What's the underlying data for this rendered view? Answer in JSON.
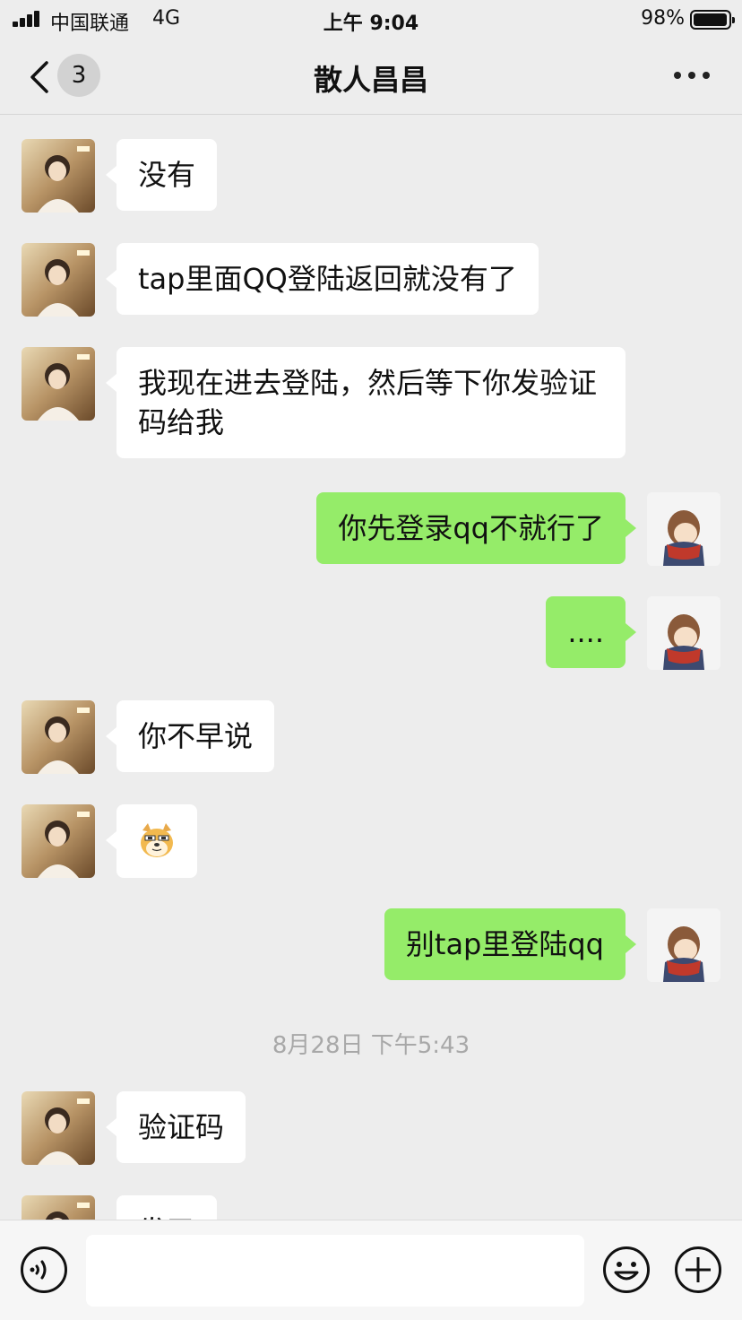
{
  "status_bar": {
    "carrier": "中国联通",
    "network": "4G",
    "time": "上午 9:04",
    "battery": "98%",
    "battery_level": 0.98
  },
  "nav": {
    "unread_count": "3",
    "title": "散人昌昌"
  },
  "messages": [
    {
      "side": "in",
      "text": "没有"
    },
    {
      "side": "in",
      "text": "tap里面QQ登陆返回就没有了"
    },
    {
      "side": "in",
      "text": "我现在进去登陆，然后等下你发验证码给我"
    },
    {
      "side": "out",
      "text": "你先登录qq不就行了"
    },
    {
      "side": "out",
      "text": "...."
    },
    {
      "side": "in",
      "text": "你不早说"
    },
    {
      "side": "in",
      "sticker": "doge-emoji-icon"
    },
    {
      "side": "out",
      "text": "别tap里登陆qq"
    },
    {
      "side": "in",
      "text": "验证码"
    },
    {
      "side": "in",
      "text": "发了"
    }
  ],
  "divider_timestamp": "8月28日 下午5:43",
  "colors": {
    "background": "#ededed",
    "outgoing_bubble": "#95ec69",
    "incoming_bubble": "#ffffff",
    "timestamp_text": "#a8a8a8"
  },
  "icons": {
    "back": "chevron-left-icon",
    "more": "more-dots-icon",
    "voice": "voice-input-icon",
    "emoji": "emoji-icon",
    "plus": "plus-icon"
  }
}
